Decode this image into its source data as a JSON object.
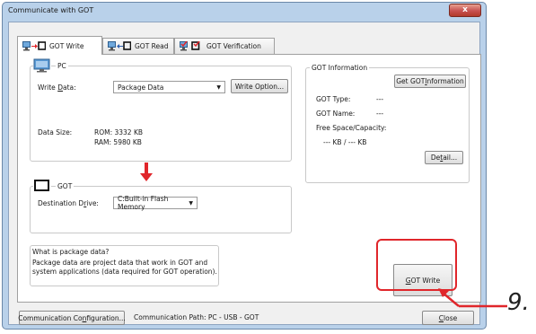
{
  "window": {
    "title": "Communicate with GOT",
    "close_glyph": "x"
  },
  "tabs": [
    {
      "label": "GOT Write",
      "icon": "pc-to-got-icon",
      "active": true
    },
    {
      "label": "GOT Read",
      "icon": "got-to-pc-icon",
      "active": false
    },
    {
      "label": "GOT Verification",
      "icon": "verification-icon",
      "active": false
    }
  ],
  "pc": {
    "label": "PC",
    "write_data_label_pre": "Write ",
    "write_data_label_u": "D",
    "write_data_label_post": "ata:",
    "write_data_value": "Package Data",
    "write_option_button": "Write Option...",
    "data_size_label": "Data Size:",
    "rom": "ROM: 3332 KB",
    "ram": "RAM: 5980 KB"
  },
  "got": {
    "label": "GOT",
    "dest_drive_label_pre": "Destination D",
    "dest_drive_label_u": "r",
    "dest_drive_label_post": "ive:",
    "dest_drive_value": "C:Built-in Flash Memory"
  },
  "got_info": {
    "title": "GOT Information",
    "get_btn_pre": "Get GOT ",
    "get_btn_u": "I",
    "get_btn_post": "nformation",
    "type_label": "GOT Type:",
    "type_value": "---",
    "name_label": "GOT Name:",
    "name_value": "---",
    "space_label": "Free Space/Capacity:",
    "space_value": "--- KB / --- KB",
    "detail_pre": "De",
    "detail_u": "t",
    "detail_post": "ail..."
  },
  "package_info": {
    "question": "What is package data?",
    "line1": "Package data are project data that work in GOT and",
    "line2": "system applications (data required for GOT operation)."
  },
  "got_write_btn": {
    "u": "G",
    "rest": "OT Write"
  },
  "footer": {
    "comm_config_pre": "Communication Co",
    "comm_config_u": "n",
    "comm_config_post": "figuration...",
    "comm_path": "Communication Path:  PC - USB - GOT",
    "close_u": "C",
    "close_post": "lose"
  },
  "annotation": {
    "number": "9."
  },
  "colors": {
    "accent_red": "#e0262b",
    "window_frame": "#b9d1ea"
  }
}
